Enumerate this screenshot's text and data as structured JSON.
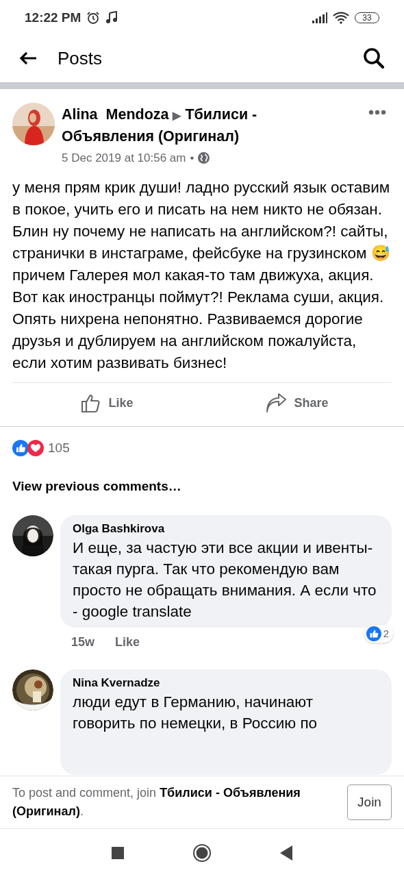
{
  "status_bar": {
    "time": "12:22 PM",
    "battery": "33"
  },
  "header": {
    "title": "Posts"
  },
  "post": {
    "author": "Alina  Mendoza",
    "group": "Тбилиси - Объявления (Оригинал)",
    "timestamp": "5 Dec 2019 at 10:56 am",
    "separator": "•",
    "caret": "▶",
    "body": "у меня прям крик души! ладно русский язык оставим в покое, учить его и писать на нем никто не обязан. Блин ну почему не написать на английском?! сайты, странички в инстаграме, фейсбуке на грузинском 😅 причем Галерея мол какая-то там движуха, акция. Вот как иностранцы поймут?! Реклама суши, акция. Опять нихрена непонятно. Развиваемся дорогие друзья и дублируем на английском пожалуйста, если хотим развивать бизнес!",
    "actions": [
      {
        "label": "Like",
        "kind": "like"
      },
      {
        "label": "Share",
        "kind": "share"
      }
    ],
    "reaction_count": "105"
  },
  "view_previous": "View previous comments…",
  "comments": [
    {
      "author": "Olga Bashkirova",
      "text": "И еще, за частую эти все акции и ивенты-такая пурга. Так что рекомендую вам просто не обращать внимания. А если что - google translate",
      "time": "15w",
      "like_label": "Like",
      "reaction_count": "2"
    },
    {
      "author": "Nina Kvernadze",
      "text": "люди едут в Германию, начинают говорить по немецки, в Россию по"
    }
  ],
  "join_bar": {
    "text": "To post and comment, join **Тбилиси - Объявления (Оригинал)**.",
    "button": "Join"
  }
}
